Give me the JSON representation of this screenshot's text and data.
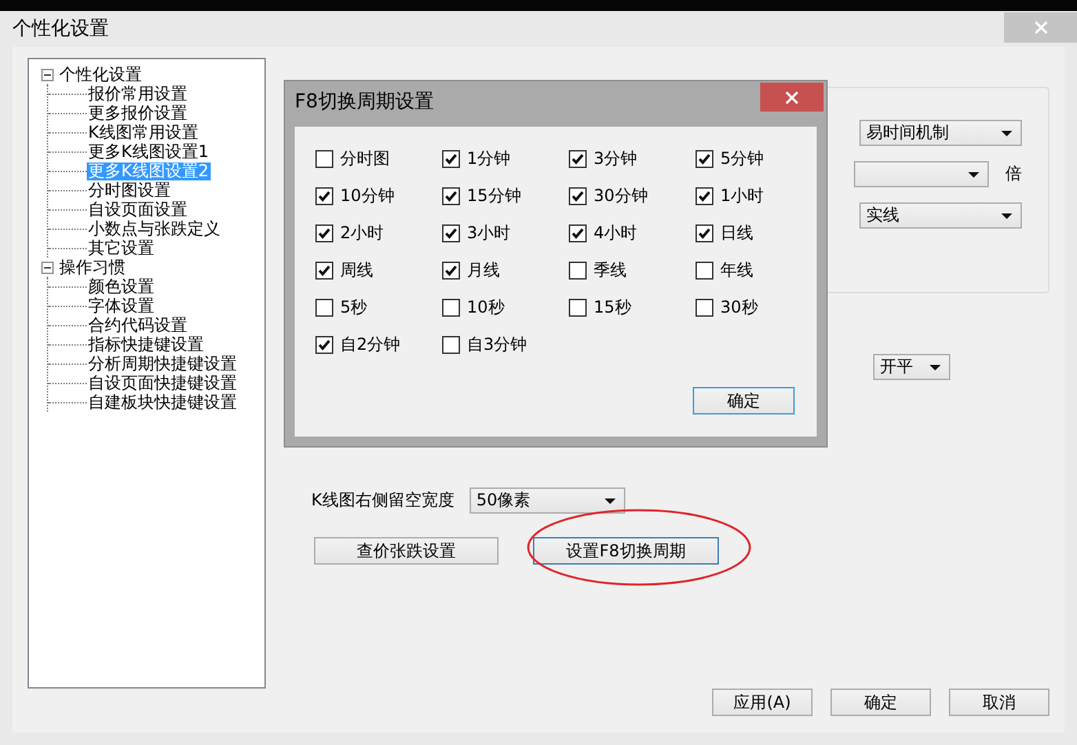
{
  "window": {
    "title": "个性化设置"
  },
  "tree": [
    {
      "label": "个性化设置",
      "expanded": true,
      "children": [
        {
          "label": "报价常用设置",
          "selected": false
        },
        {
          "label": "更多报价设置",
          "selected": false
        },
        {
          "label": "K线图常用设置",
          "selected": false
        },
        {
          "label": "更多K线图设置1",
          "selected": false
        },
        {
          "label": "更多K线图设置2",
          "selected": true
        },
        {
          "label": "分时图设置",
          "selected": false
        },
        {
          "label": "自设页面设置",
          "selected": false
        },
        {
          "label": "小数点与张跌定义",
          "selected": false
        },
        {
          "label": "其它设置",
          "selected": false
        }
      ]
    },
    {
      "label": "操作习惯",
      "expanded": true,
      "children": [
        {
          "label": "颜色设置",
          "selected": false
        },
        {
          "label": "字体设置",
          "selected": false
        },
        {
          "label": "合约代码设置",
          "selected": false
        },
        {
          "label": "指标快捷键设置",
          "selected": false
        },
        {
          "label": "分析周期快捷键设置",
          "selected": false
        },
        {
          "label": "自设页面快捷键设置",
          "selected": false
        },
        {
          "label": "自建板块快捷键设置",
          "selected": false
        }
      ]
    }
  ],
  "group_fields": [
    {
      "value": "易时间机制"
    },
    {
      "unit": "倍"
    },
    {
      "value": "实线"
    }
  ],
  "order_mode": {
    "value": "开平"
  },
  "margin_width": {
    "label": "K线图右侧留空宽度",
    "value": "50像素"
  },
  "buttons": [
    {
      "label": "查价张跌设置",
      "focused": false,
      "circled": false
    },
    {
      "label": "设置F8切换周期",
      "focused": true,
      "circled": true
    }
  ],
  "footer_buttons": [
    "应用(A)",
    "确定",
    "取消"
  ],
  "dialog": {
    "title": "F8切换周期设置",
    "options": [
      {
        "label": "分时图",
        "checked": false
      },
      {
        "label": "1分钟",
        "checked": true
      },
      {
        "label": "3分钟",
        "checked": true
      },
      {
        "label": "5分钟",
        "checked": true
      },
      {
        "label": "10分钟",
        "checked": true
      },
      {
        "label": "15分钟",
        "checked": true
      },
      {
        "label": "30分钟",
        "checked": true
      },
      {
        "label": "1小时",
        "checked": true
      },
      {
        "label": "2小时",
        "checked": true
      },
      {
        "label": "3小时",
        "checked": true
      },
      {
        "label": "4小时",
        "checked": true
      },
      {
        "label": "日线",
        "checked": true
      },
      {
        "label": "周线",
        "checked": true
      },
      {
        "label": "月线",
        "checked": true
      },
      {
        "label": "季线",
        "checked": false
      },
      {
        "label": "年线",
        "checked": false
      },
      {
        "label": "5秒",
        "checked": false
      },
      {
        "label": "10秒",
        "checked": false
      },
      {
        "label": "15秒",
        "checked": false
      },
      {
        "label": "30秒",
        "checked": false
      },
      {
        "label": "自2分钟",
        "checked": true
      },
      {
        "label": "自3分钟",
        "checked": false
      }
    ],
    "ok_button": "确定"
  }
}
